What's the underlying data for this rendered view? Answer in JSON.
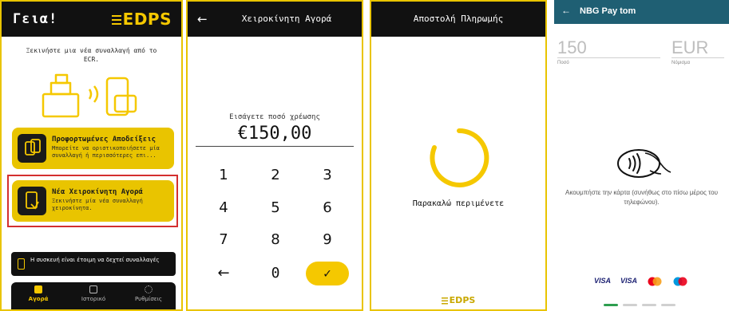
{
  "colors": {
    "accent": "#F5C800",
    "dark": "#111111",
    "highlight": "#D32F2F",
    "nbg": "#1F5F73"
  },
  "home": {
    "greeting": "Γεια!",
    "logo_text": "EDPS",
    "intro": "Ξεκινήστε μια νέα συναλλαγή από το ECR.",
    "cards": [
      {
        "title": "Προφορτωμένες Αποδείξεις",
        "desc": "Μπορείτε να οριστικοποιήσετε μία συναλλαγή ή περισσότερες επι...",
        "icon": "receipt-icon"
      },
      {
        "title": "Νέα Χειροκίνητη Αγορά",
        "desc": "Ξεκινήστε μία νέα συναλλαγή χειροκίνητα.",
        "icon": "manual-purchase-icon"
      }
    ],
    "status": "Η συσκευή είναι έτοιμη να δεχτεί συναλλαγές",
    "nav": [
      {
        "label": "Αγορά",
        "icon": "wallet-icon",
        "active": true
      },
      {
        "label": "Ιστορικό",
        "icon": "history-icon",
        "active": false
      },
      {
        "label": "Ρυθμίσεις",
        "icon": "gear-icon",
        "active": false
      }
    ]
  },
  "manual": {
    "back": "←",
    "title": "Χειροκίνητη Αγορά",
    "amount_label": "Εισάγετε ποσό χρέωσης",
    "amount": "€150,00",
    "keys": [
      "1",
      "2",
      "3",
      "4",
      "5",
      "6",
      "7",
      "8",
      "9",
      "←",
      "0",
      "✓"
    ]
  },
  "sending": {
    "title": "Αποστολή Πληρωμής",
    "wait": "Παρακαλώ περιμένετε",
    "logo_text": "EDPS"
  },
  "nbg": {
    "back": "←",
    "title": "NBG Pay tom",
    "amount": "150",
    "currency": "EUR",
    "amount_label": "Ποσό",
    "currency_label": "Νόμισμα",
    "tap_message": "Ακουμπήστε την κάρτα (συνήθως στο πίσω μέρος του τηλεφώνου).",
    "brands": [
      "VISA",
      "VISA",
      "mastercard",
      "maestro"
    ]
  }
}
